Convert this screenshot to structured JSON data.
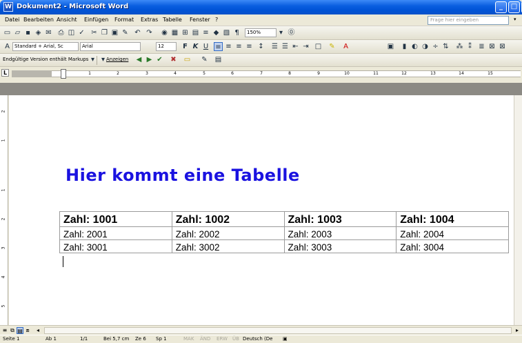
{
  "window": {
    "title": "Dokument2 - Microsoft Word",
    "icon_letter": "W"
  },
  "menubar": {
    "items": [
      "Datei",
      "Bearbeiten",
      "Ansicht",
      "Einfügen",
      "Format",
      "Extras",
      "Tabelle",
      "Fenster",
      "?"
    ],
    "help_placeholder": "Frage hier eingeben"
  },
  "toolbar_standard": {
    "zoom": "150%"
  },
  "toolbar_format": {
    "style": "Standard + Arial, Sc",
    "font": "Arial",
    "size": "12"
  },
  "toolbar_review": {
    "markup_view": "Endgültige Version enthält Markups",
    "show_label": "Anzeigen"
  },
  "ruler": {
    "numbers": [
      "1",
      "1",
      "2",
      "3",
      "4",
      "5",
      "6",
      "7",
      "8",
      "9",
      "10",
      "11",
      "12",
      "13",
      "14",
      "15"
    ],
    "vertical_numbers": [
      "2",
      "1",
      "1",
      "2",
      "3",
      "4",
      "5"
    ]
  },
  "document": {
    "heading": "Hier kommt eine Tabelle",
    "table": [
      [
        "Zahl: 1001",
        "Zahl: 1002",
        "Zahl: 1003",
        "Zahl: 1004"
      ],
      [
        "Zahl: 2001",
        "Zahl: 2002",
        "Zahl: 2003",
        "Zahl: 2004"
      ],
      [
        "Zahl: 3001",
        "Zahl: 3002",
        "Zahl: 3003",
        "Zahl: 3004"
      ]
    ]
  },
  "statusbar": {
    "page": "Seite 1",
    "section": "Ab 1",
    "pages": "1/1",
    "position": "Bei 5,7 cm",
    "line": "Ze 6",
    "column": "Sp 1",
    "mak": "MAK",
    "and": "ÄND",
    "erw": "ERW",
    "ub": "ÜB",
    "language": "Deutsch (De"
  },
  "colors": {
    "heading": "#1a12e0",
    "titlebar": "#0053d6"
  }
}
